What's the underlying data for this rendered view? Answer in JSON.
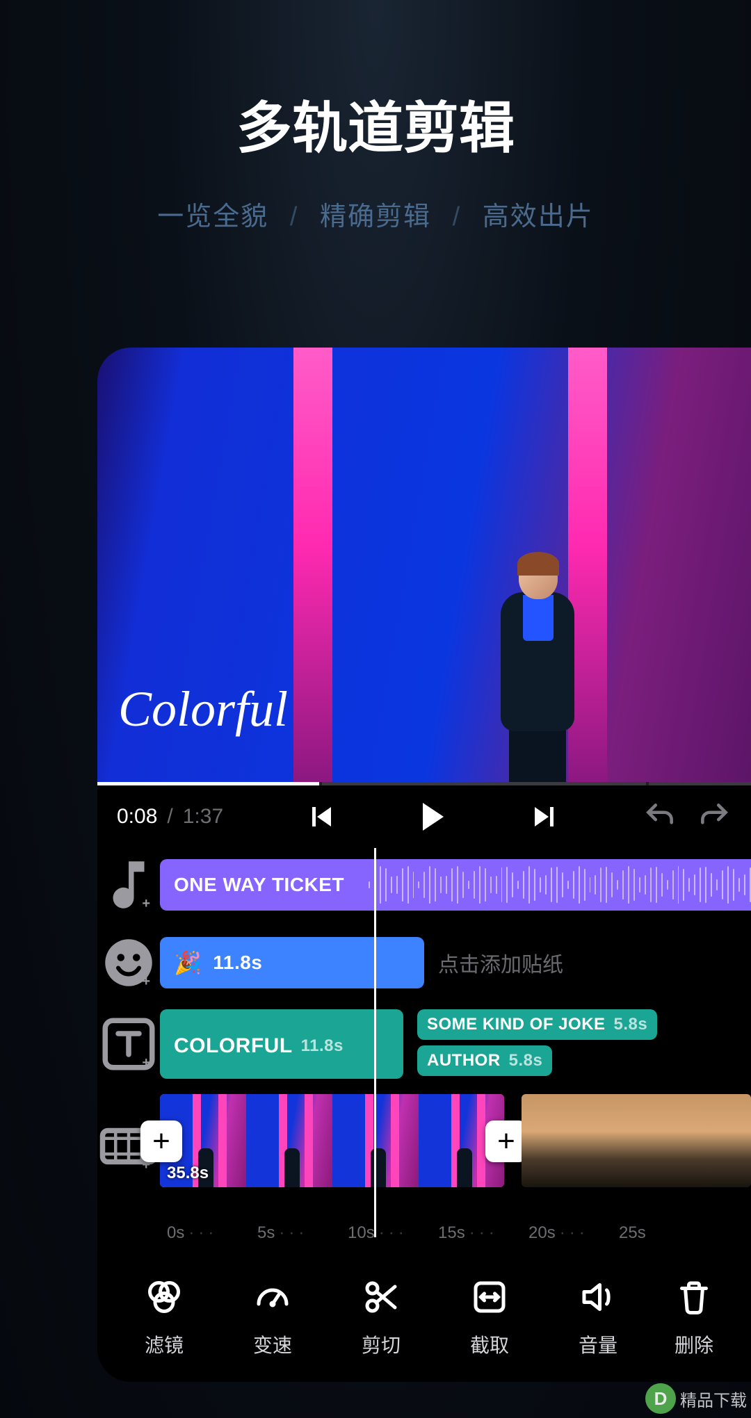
{
  "hero": {
    "title": "多轨道剪辑",
    "sub_parts": [
      "一览全貌",
      "精确剪辑",
      "高效出片"
    ]
  },
  "preview": {
    "overlay_text": "Colorful",
    "segments": [
      {
        "color": "#ffffff",
        "flex": 1.3
      },
      {
        "color": "#3a3a3f",
        "flex": 1.9
      },
      {
        "color": "#3a3a3f",
        "flex": 0.6
      }
    ]
  },
  "playbar": {
    "current": "0:08",
    "total": "1:37"
  },
  "tracks": {
    "music": {
      "title": "ONE WAY TICKET"
    },
    "sticker": {
      "emoji": "🎉",
      "duration": "11.8s",
      "hint": "点击添加贴纸"
    },
    "text": {
      "main": {
        "label": "COLORFUL",
        "duration": "11.8s"
      },
      "subs": [
        {
          "label": "SOME KIND OF JOKE",
          "duration": "5.8s"
        },
        {
          "label": "AUTHOR",
          "duration": "5.8s"
        }
      ]
    },
    "video": {
      "clips": [
        {
          "duration": "35.8s",
          "selected": true
        },
        {
          "duration": ""
        }
      ]
    }
  },
  "ruler": [
    "0s",
    "5s",
    "10s",
    "15s",
    "20s",
    "25s"
  ],
  "toolbar": [
    {
      "id": "filter",
      "label": "滤镜"
    },
    {
      "id": "speed",
      "label": "变速"
    },
    {
      "id": "cut",
      "label": "剪切"
    },
    {
      "id": "crop",
      "label": "截取"
    },
    {
      "id": "volume",
      "label": "音量"
    },
    {
      "id": "delete",
      "label": "删除"
    }
  ],
  "watermark": {
    "main": "精品下载"
  }
}
